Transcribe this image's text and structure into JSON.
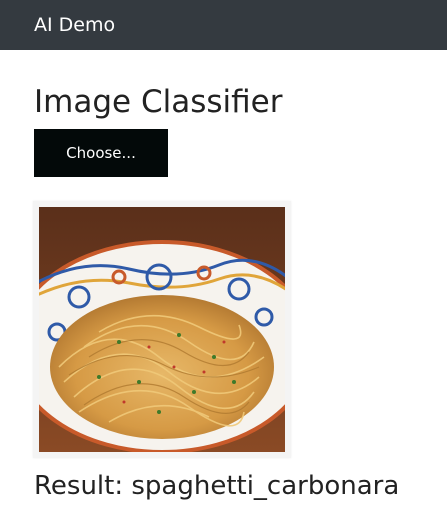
{
  "navbar": {
    "brand": "AI Demo"
  },
  "main": {
    "title": "Image Classifier",
    "choose_button_label": "Choose...",
    "preview_image": "spaghetti-photo",
    "result_label": "Result:",
    "result_value": "spaghetti_carbonara",
    "result_text": "Result: spaghetti_carbonara"
  },
  "colors": {
    "navbar_bg": "#343a40",
    "button_bg": "#030909"
  }
}
